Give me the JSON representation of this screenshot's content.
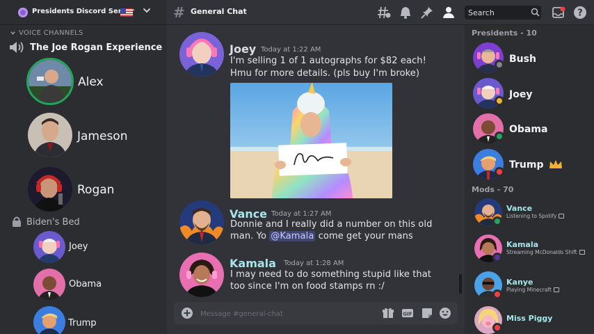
{
  "server": {
    "name": "Presidents Discord Server"
  },
  "voice": {
    "category": "VOICE CHANNELS",
    "channels": [
      {
        "name": "The Joe Rogan Experience",
        "members": [
          "Alex",
          "Jameson",
          "Rogan"
        ]
      },
      {
        "name": "Biden's Bed",
        "members": [
          "Joey",
          "Obama",
          "Trump"
        ]
      }
    ]
  },
  "topbar": {
    "channel": "General Chat",
    "search_placeholder": "Search"
  },
  "messages": [
    {
      "author": "Joey",
      "time": "Today at 1:22 AM",
      "author_color": "#f0c8ec",
      "lines": [
        "I'm selling 1 of 1 autographs for $82 each!",
        "Hmu for more details. (pls buy I'm broke)"
      ]
    },
    {
      "author": "Vance",
      "time": "Today at 1:27 AM",
      "author_color": "#a6e6ea",
      "line1": "Donnie and I really did a number on this old",
      "line2_pre": "man. Yo ",
      "mention": "@Kamala",
      "line2_post": " come get your mans"
    },
    {
      "author": "Kamala",
      "time": "Today at 1:28 AM",
      "author_color": "#a6e6ea",
      "lines": [
        "I may need to do something stupid like that",
        "too since I'm on food stamps rn :/"
      ]
    }
  ],
  "composer": {
    "placeholder": "Message #general-chat"
  },
  "members": {
    "presidents": {
      "header": "Presidents - 10",
      "people": [
        {
          "name": "Bush",
          "status": "idle-gray"
        },
        {
          "name": "Joey",
          "status": "idle"
        },
        {
          "name": "Obama",
          "status": "online"
        },
        {
          "name": "Trump",
          "status": "dnd",
          "crown": true
        }
      ]
    },
    "mods": {
      "header": "Mods - 70",
      "people": [
        {
          "name": "Vance",
          "activity": "Listening to Spotify",
          "status": "online",
          "color": "#a6e6ea"
        },
        {
          "name": "Kamala",
          "activity": "Streaming McDonalds Shift",
          "status": "streaming",
          "color": "#a6e6ea"
        },
        {
          "name": "Kanye",
          "activity": "Playing Minecraft",
          "status": "dnd",
          "color": "#a6e6ea"
        },
        {
          "name": "Miss Piggy",
          "activity": "",
          "status": "dnd",
          "color": "#a6e6ea"
        }
      ]
    }
  },
  "colors": {
    "online": "#23a55a",
    "idle": "#f0b232",
    "dnd": "#f23f43",
    "streaming": "#593695",
    "offline": "#80848e"
  },
  "icons": [
    "server-icon",
    "us-flag-icon",
    "chevron-down-icon",
    "hash-icon",
    "threads-icon",
    "bell-icon",
    "pin-icon",
    "members-icon",
    "search-icon",
    "inbox-icon",
    "help-icon",
    "speaker-icon",
    "lock-icon",
    "add-circle-icon",
    "gift-icon",
    "gif-icon",
    "sticker-icon",
    "emoji-icon",
    "crown-icon"
  ]
}
